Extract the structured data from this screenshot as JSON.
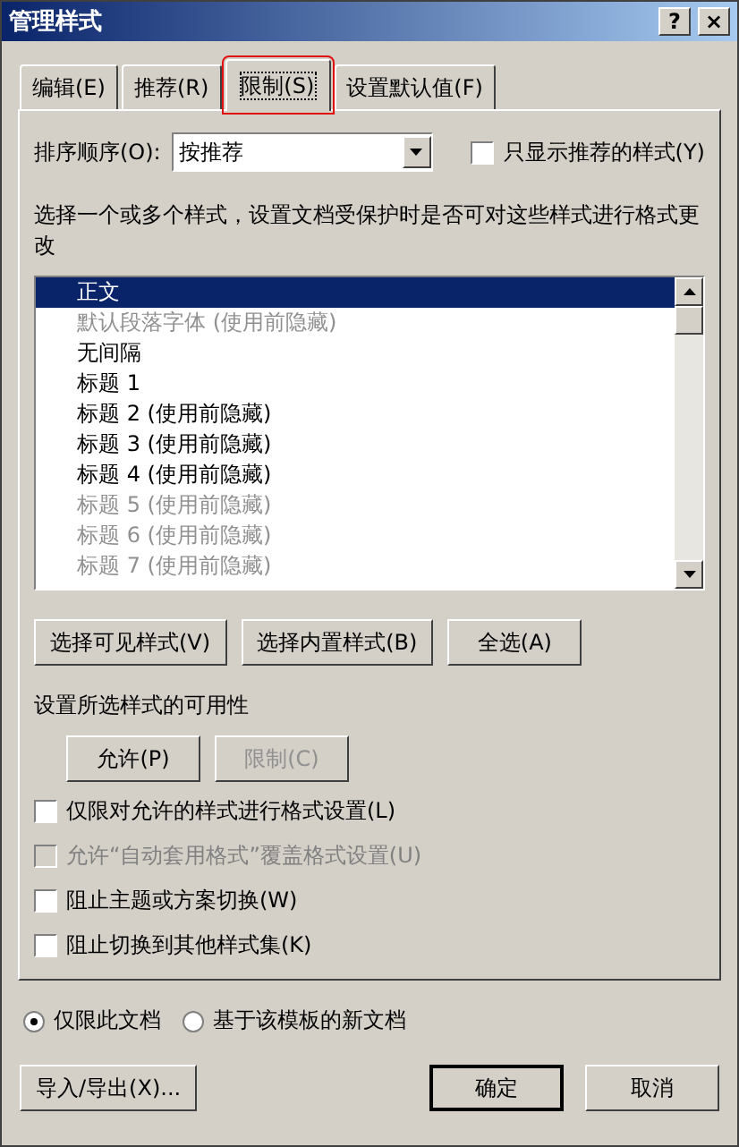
{
  "window": {
    "title": "管理样式"
  },
  "title_buttons": [
    "?",
    "×"
  ],
  "tabs": [
    {
      "label": "编辑(E)",
      "selected": false
    },
    {
      "label": "推荐(R)",
      "selected": false
    },
    {
      "label": "限制(S)",
      "selected": true
    },
    {
      "label": "设置默认值(F)",
      "selected": false
    }
  ],
  "sort": {
    "label": "排序顺序(O):",
    "value": "按推荐"
  },
  "only_recommended": {
    "label": "只显示推荐的样式(Y)",
    "checked": false
  },
  "instruction": "选择一个或多个样式，设置文档受保护时是否可对这些样式进行格式更改",
  "styles": [
    {
      "text": "正文",
      "selected": true,
      "disabled": false
    },
    {
      "text": "默认段落字体 (使用前隐藏)",
      "selected": false,
      "disabled": true
    },
    {
      "text": "无间隔",
      "selected": false,
      "disabled": false
    },
    {
      "text": "标题 1",
      "selected": false,
      "disabled": false
    },
    {
      "text": "标题 2 (使用前隐藏)",
      "selected": false,
      "disabled": false
    },
    {
      "text": "标题 3 (使用前隐藏)",
      "selected": false,
      "disabled": false
    },
    {
      "text": "标题 4 (使用前隐藏)",
      "selected": false,
      "disabled": false
    },
    {
      "text": "标题 5 (使用前隐藏)",
      "selected": false,
      "disabled": true
    },
    {
      "text": "标题 6 (使用前隐藏)",
      "selected": false,
      "disabled": true
    },
    {
      "text": "标题 7 (使用前隐藏)",
      "selected": false,
      "disabled": true
    }
  ],
  "select_buttons": [
    {
      "label": "选择可见样式(V)",
      "disabled": false
    },
    {
      "label": "选择内置样式(B)",
      "disabled": false
    },
    {
      "label": "全选(A)",
      "disabled": false
    }
  ],
  "availability": {
    "label": "设置所选样式的可用性",
    "buttons": [
      {
        "label": "允许(P)",
        "disabled": false
      },
      {
        "label": "限制(C)",
        "disabled": true
      }
    ]
  },
  "options": [
    {
      "label": "仅限对允许的样式进行格式设置(L)",
      "checked": false,
      "disabled": false
    },
    {
      "label": "允许“自动套用格式”覆盖格式设置(U)",
      "checked": false,
      "disabled": true
    },
    {
      "label": "阻止主题或方案切换(W)",
      "checked": false,
      "disabled": false
    },
    {
      "label": "阻止切换到其他样式集(K)",
      "checked": false,
      "disabled": false
    }
  ],
  "scope": [
    {
      "label": "仅限此文档",
      "selected": true
    },
    {
      "label": "基于该模板的新文档",
      "selected": false
    }
  ],
  "footer": {
    "import_export": "导入/导出(X)...",
    "ok": "确定",
    "cancel": "取消"
  }
}
